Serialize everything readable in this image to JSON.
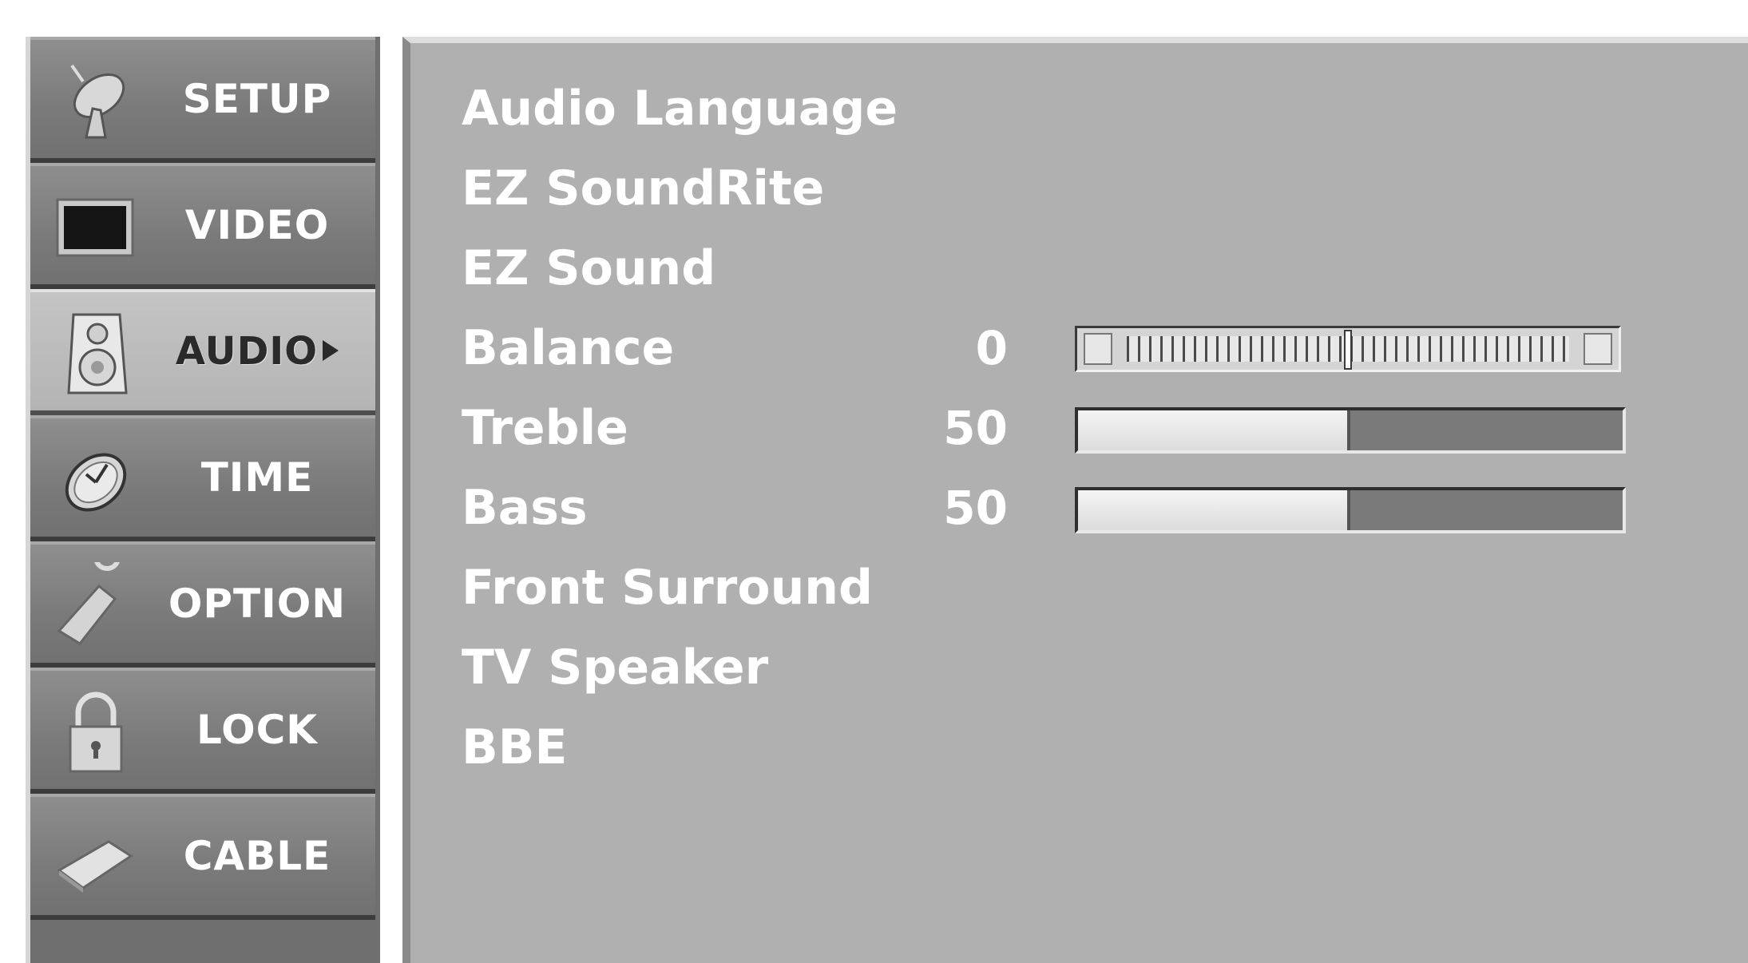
{
  "sidebar": {
    "items": [
      {
        "label": "SETUP",
        "icon": "satellite-dish-icon",
        "active": false
      },
      {
        "label": "VIDEO",
        "icon": "screen-icon",
        "active": false
      },
      {
        "label": "AUDIO",
        "icon": "speaker-icon",
        "active": true
      },
      {
        "label": "TIME",
        "icon": "clock-icon",
        "active": false
      },
      {
        "label": "OPTION",
        "icon": "tag-icon",
        "active": false
      },
      {
        "label": "LOCK",
        "icon": "padlock-icon",
        "active": false
      },
      {
        "label": "CABLE",
        "icon": "cable-card-icon",
        "active": false
      }
    ]
  },
  "menu": {
    "items": [
      {
        "label": "Audio Language"
      },
      {
        "label": "EZ SoundRite"
      },
      {
        "label": "EZ Sound"
      },
      {
        "label": "Balance",
        "value": "0",
        "control": "balance-slider"
      },
      {
        "label": "Treble",
        "value": "50",
        "control": "level-bar",
        "fraction": 0.5
      },
      {
        "label": "Bass",
        "value": "50",
        "control": "level-bar",
        "fraction": 0.5
      },
      {
        "label": "Front Surround"
      },
      {
        "label": "TV Speaker"
      },
      {
        "label": "BBE"
      }
    ]
  },
  "balance": {
    "min": -50,
    "max": 50,
    "value": 0
  },
  "colors": {
    "panel": "#b0b0b0",
    "sidebar": "#7a7a7a",
    "active_item": "#bcbcbc",
    "text": "#ffffff"
  }
}
